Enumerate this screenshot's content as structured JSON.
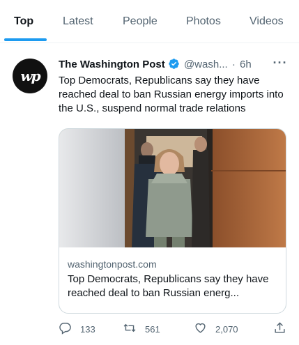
{
  "tabs": [
    {
      "label": "Top",
      "active": true
    },
    {
      "label": "Latest",
      "active": false
    },
    {
      "label": "People",
      "active": false
    },
    {
      "label": "Photos",
      "active": false
    },
    {
      "label": "Videos",
      "active": false
    }
  ],
  "tweet": {
    "author_name": "The Washington Post",
    "verified": true,
    "handle": "@wash...",
    "separator": "·",
    "time": "6h",
    "text": "Top Democrats, Republicans say they have reached deal to ban Russian energy imports into the U.S., suspend normal trade relations",
    "avatar_icon": "washington-post-logo",
    "card": {
      "domain": "washingtonpost.com",
      "title": "Top Democrats, Republicans say they have reached deal to ban Russian energ..."
    },
    "stats": {
      "replies": "133",
      "retweets": "561",
      "likes": "2,070"
    }
  },
  "colors": {
    "accent": "#1d9bf0",
    "secondary_text": "#536471",
    "primary_text": "#0f1419",
    "border": "#cfd9de"
  }
}
